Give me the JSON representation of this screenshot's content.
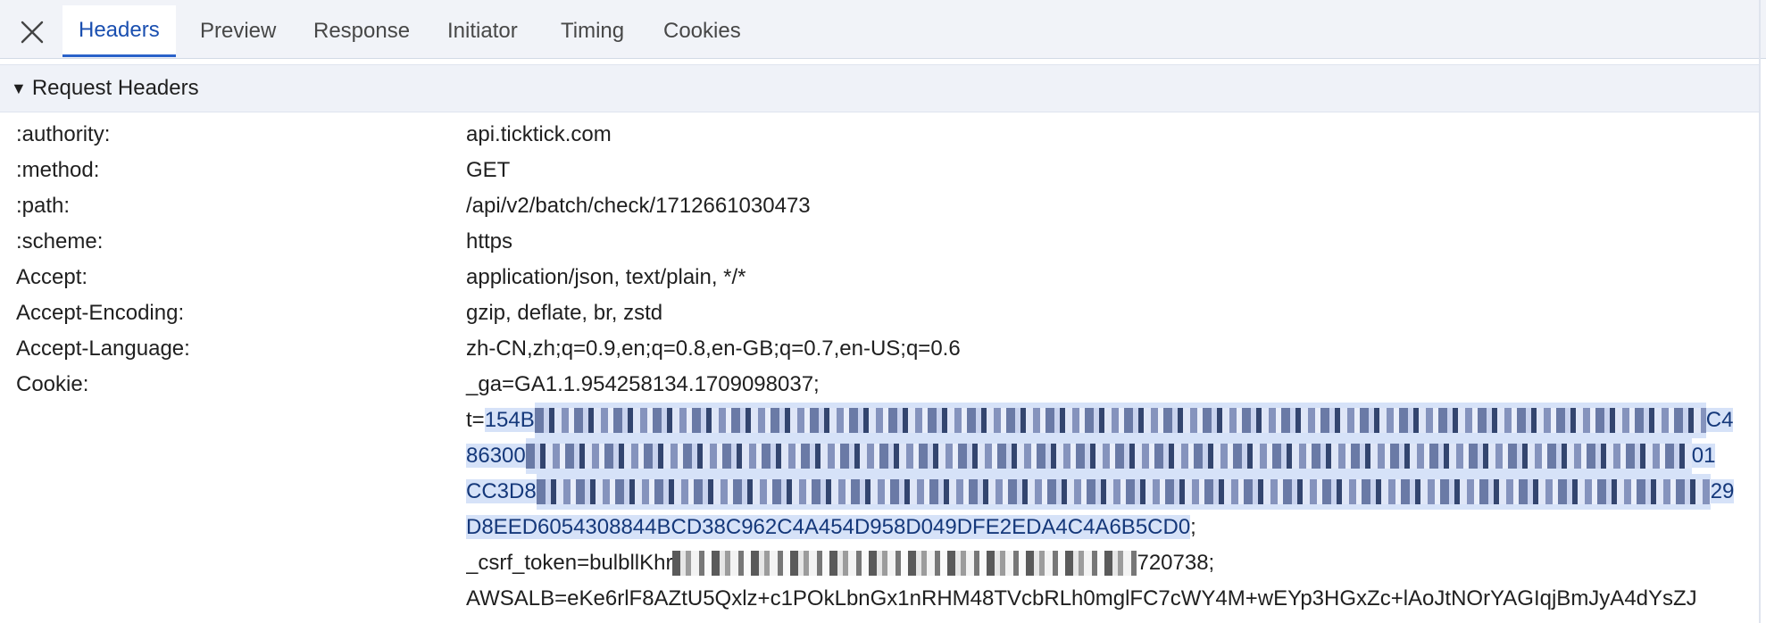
{
  "tabs": {
    "close_icon": "close-icon",
    "items": [
      "Headers",
      "Preview",
      "Response",
      "Initiator",
      "Timing",
      "Cookies"
    ],
    "active": "Headers"
  },
  "section": {
    "toggle": "▼",
    "title": "Request Headers"
  },
  "headers": [
    {
      "name": ":authority:",
      "value": "api.ticktick.com"
    },
    {
      "name": ":method:",
      "value": "GET"
    },
    {
      "name": ":path:",
      "value": "/api/v2/batch/check/1712661030473"
    },
    {
      "name": ":scheme:",
      "value": "https"
    },
    {
      "name": "Accept:",
      "value": "application/json, text/plain, */*"
    },
    {
      "name": "Accept-Encoding:",
      "value": "gzip, deflate, br, zstd"
    },
    {
      "name": "Accept-Language:",
      "value": "zh-CN,zh;q=0.9,en;q=0.8,en-GB;q=0.7,en-US;q=0.6"
    },
    {
      "name": "Cookie:",
      "value": "_ga=GA1.1.954258134.1709098037;"
    }
  ],
  "cookie": {
    "t_line1_prefix": "t=",
    "t_line1_sel_start": "154B",
    "t_line1_end": "C4",
    "t_line2_start": "86300",
    "t_line2_end": "01",
    "t_line3_start": "CC3D8",
    "t_line3_end": "29",
    "t_line4": "D8EED6054308844BCD38C962C4A454D958D049DFE2EDA4C4A6B5CD0",
    "t_line4_suffix": ";",
    "csrf_start": "_csrf_token=bulbllKhr",
    "csrf_end": "720738;",
    "awsalb": "AWSALB=eKe6rlF8AZtU5Qxlz+c1POkLbnGx1nRHM48TVcbRLh0mglFC7cWY4M+wEYp3HGxZc+lAoJtNOrYAGIqjBmJyA4dYsZJ"
  },
  "colors": {
    "accent": "#1a4fb0",
    "selection": "#d6e2f8",
    "tabbar_bg": "#f1f3f8"
  }
}
